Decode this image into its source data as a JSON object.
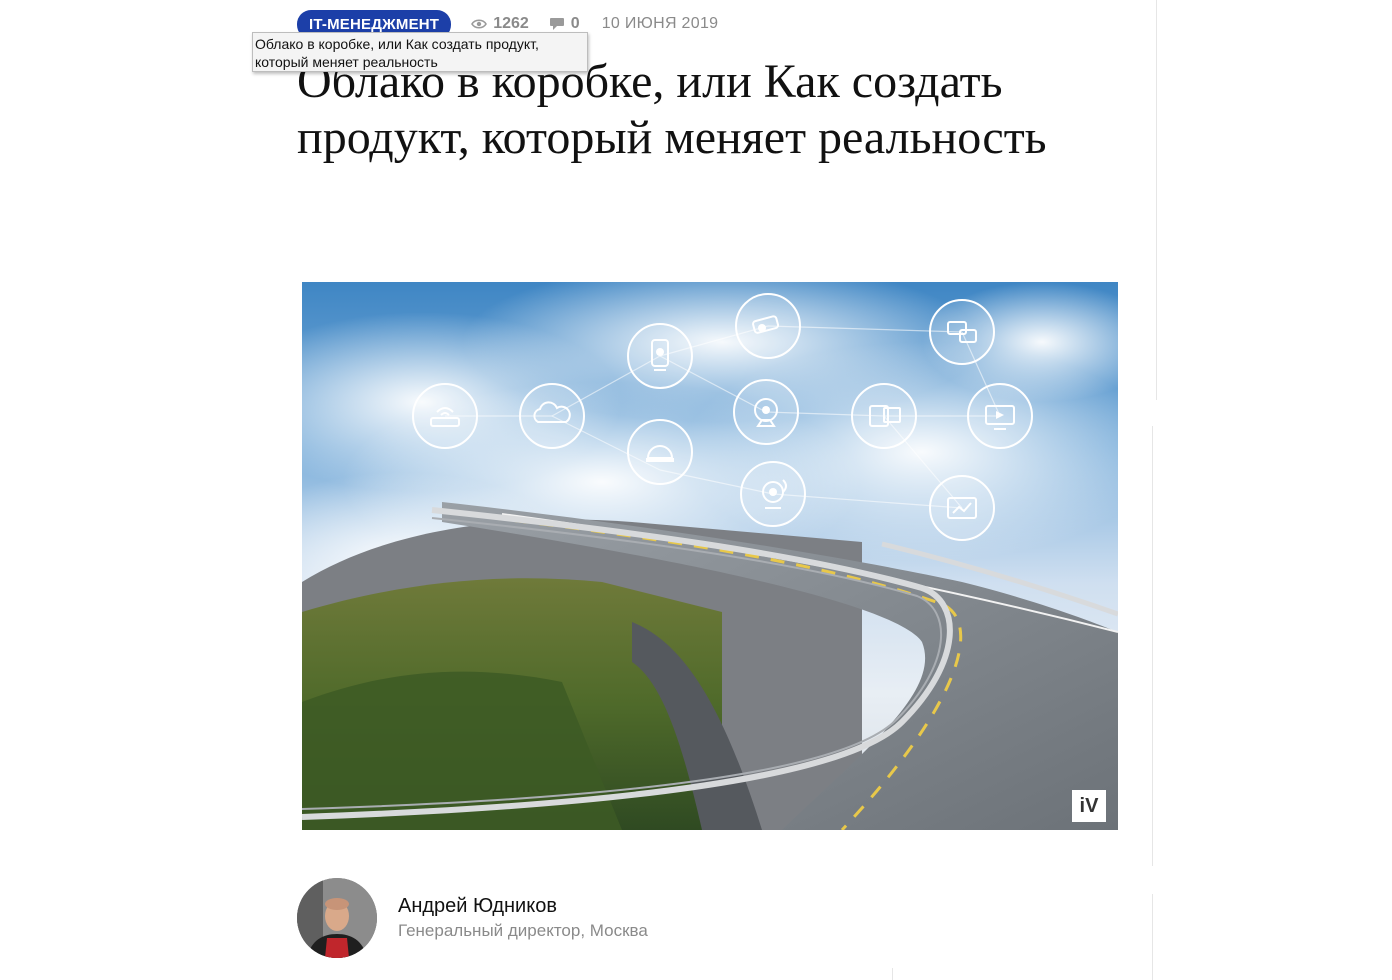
{
  "article": {
    "category": "IT-МЕНЕДЖМЕНТ",
    "views": "1262",
    "comments": "0",
    "date": "10 ИЮНЯ 2019",
    "title": "Облако в коробке, или Как создать продукт, который меняет реальность"
  },
  "tooltip": {
    "line1": "Облако в коробке, или Как создать продукт,",
    "line2": "который меняет реальность"
  },
  "hero": {
    "watermark": "iV",
    "icons": [
      "wifi-router-icon",
      "cloud-icon",
      "ip-camera-icon",
      "cctv-camera-icon",
      "chat-icon",
      "webcam-icon",
      "devices-icon",
      "monitor-icon",
      "dome-camera-icon",
      "smart-camera-icon",
      "analytics-screen-icon"
    ]
  },
  "author": {
    "name": "Андрей Юдников",
    "role": "Генеральный директор, Москва"
  },
  "colors": {
    "badge": "#1c3fa8",
    "meta": "#8a8a8a",
    "text": "#111111"
  }
}
